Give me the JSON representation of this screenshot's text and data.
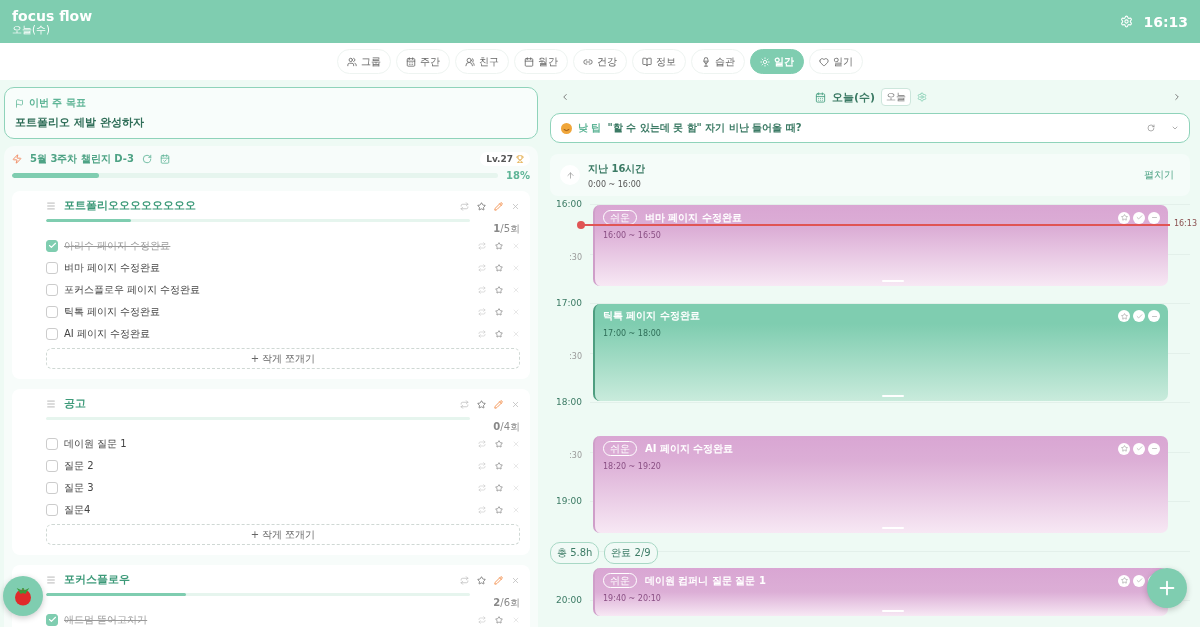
{
  "header": {
    "title": "focus flow",
    "subtitle": "오늘(수)",
    "time": "16:13"
  },
  "tabs": [
    {
      "label": "그룹",
      "selected": false
    },
    {
      "label": "주간",
      "selected": false
    },
    {
      "label": "친구",
      "selected": false
    },
    {
      "label": "월간",
      "selected": false
    },
    {
      "label": "건강",
      "selected": false
    },
    {
      "label": "정보",
      "selected": false
    },
    {
      "label": "습관",
      "selected": false
    },
    {
      "label": "일간",
      "selected": true
    },
    {
      "label": "일기",
      "selected": false
    }
  ],
  "goal": {
    "label": "이번 주 목표",
    "text": "포트폴리오 제발 완성하자"
  },
  "challenge": {
    "title": "5월 3주차 챌린지 D-3",
    "level_badge": "Lv.27",
    "level": 0.18,
    "percent": "18%"
  },
  "groups": [
    {
      "title": "포트폴리오오오오오오오오",
      "level": 0.2,
      "count": "**1**/5회",
      "tasks": [
        {
          "label": "아리수 페이지 수정완료",
          "checked": true
        },
        {
          "label": "벼마 페이지 수정완료",
          "checked": false
        },
        {
          "label": "포커스플로우 페이지 수정완료",
          "checked": false
        },
        {
          "label": "틱톡 페이지 수정완료",
          "checked": false
        },
        {
          "label": "AI 페이지 수정완료",
          "checked": false
        }
      ],
      "add_label": "+ 작게 쪼개기"
    },
    {
      "title": "공고",
      "level": 0,
      "count": "**0**/4회",
      "tasks": [
        {
          "label": "데이원 질문 1",
          "checked": false
        },
        {
          "label": "질문 2",
          "checked": false
        },
        {
          "label": "질문 3",
          "checked": false
        },
        {
          "label": "질문4",
          "checked": false
        }
      ],
      "add_label": "+ 작게 쪼개기"
    },
    {
      "title": "포커스플로우",
      "level": 0.33,
      "count": "**2**/6회",
      "tasks": [
        {
          "label": "애드멈 뜯어고치기",
          "checked": true
        }
      ]
    }
  ],
  "day": {
    "date": "오늘(수)",
    "today_button": "오늘"
  },
  "tip": {
    "label": "낮 팁",
    "text": "\"할 수 있는데 못 함\" 자기 비난 들어올 때?"
  },
  "past": {
    "title": "지난 16시간",
    "range": "0:00 ~ 16:00",
    "expand": "펼치기"
  },
  "slots": [
    {
      "kind": "hour",
      "label": "16:00"
    },
    {
      "kind": "half",
      "label": ":30"
    },
    {
      "kind": "hour",
      "label": "17:00"
    },
    {
      "kind": "half",
      "label": ":30"
    },
    {
      "kind": "hour",
      "label": "18:00"
    },
    {
      "kind": "half",
      "label": ":30"
    },
    {
      "kind": "hour",
      "label": "19:00"
    },
    {
      "kind": "blank"
    },
    {
      "kind": "hour",
      "label": "20:00"
    }
  ],
  "now": {
    "label": "16:13"
  },
  "events": [
    {
      "kind": "pink",
      "tag": "쉬운",
      "title": "벼마 페이지 수정완료",
      "range": "16:00 ~ 16:50"
    },
    {
      "kind": "green",
      "title": "틱톡 페이지 수정완료",
      "range": "17:00 ~ 18:00"
    },
    {
      "kind": "pink",
      "tag": "쉬운",
      "title": "AI 페이지 수정완료",
      "range": "18:20 ~ 19:20"
    },
    {
      "kind": "pink",
      "tag": "쉬운",
      "title": "데이원 컴퍼니 질문 질문 1",
      "range": "19:40 ~ 20:10"
    }
  ],
  "summary": [
    "총 5.8h",
    "완료 2/9"
  ]
}
